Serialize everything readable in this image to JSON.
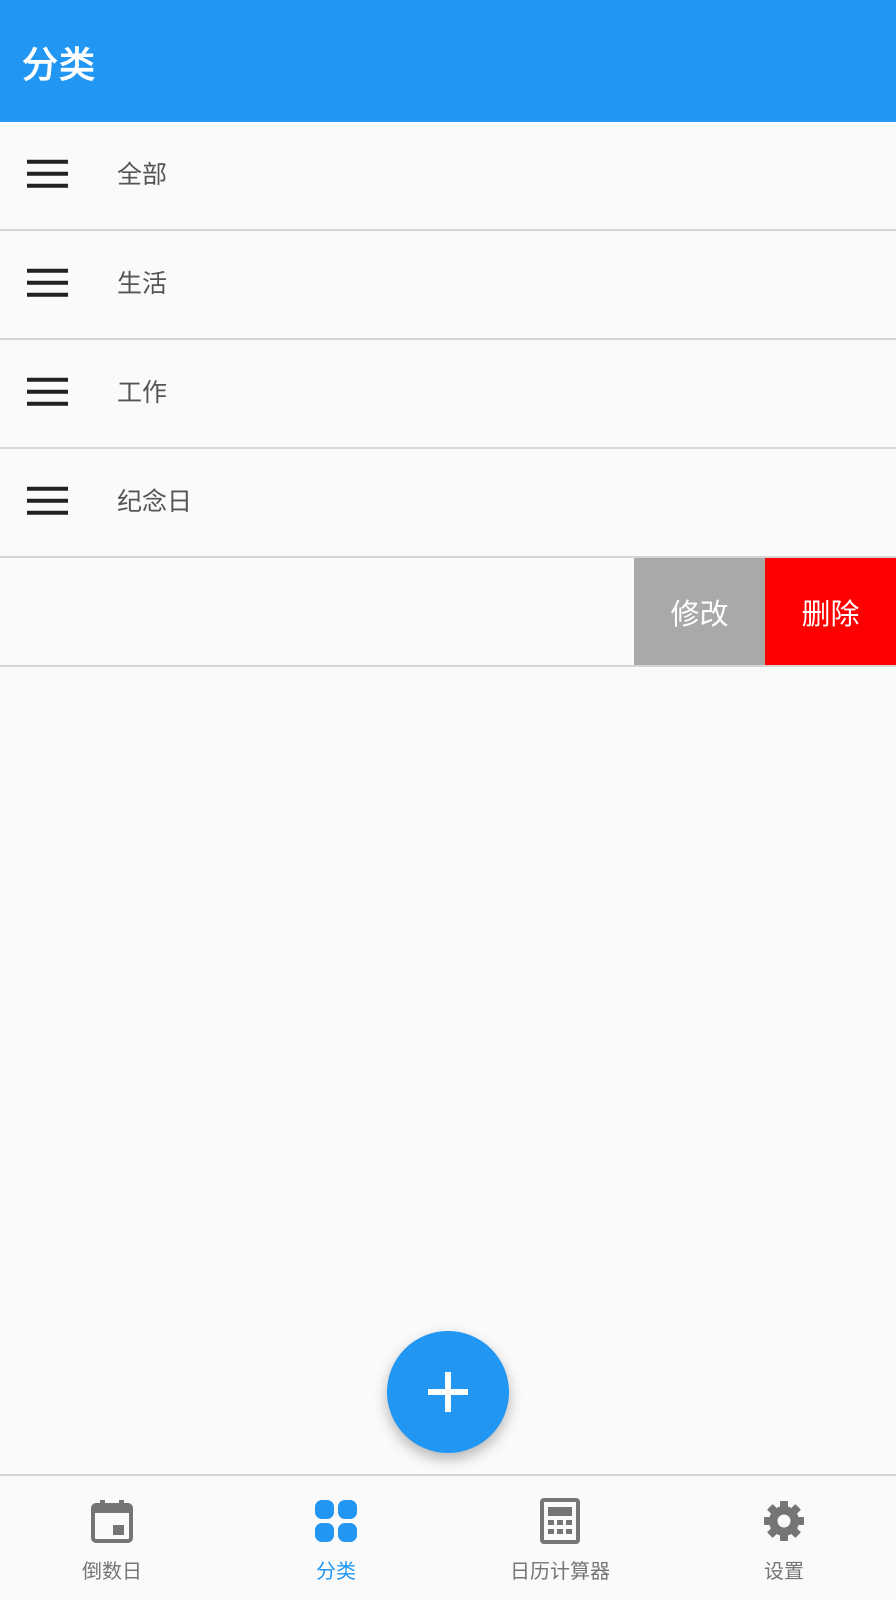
{
  "app_bar": {
    "title": "分类"
  },
  "categories": [
    {
      "label": "全部"
    },
    {
      "label": "生活"
    },
    {
      "label": "工作"
    },
    {
      "label": "纪念日"
    }
  ],
  "swipe_actions": {
    "edit_label": "修改",
    "delete_label": "删除"
  },
  "fab": {
    "icon": "plus-icon"
  },
  "bottom_nav": {
    "items": [
      {
        "label": "倒数日",
        "icon": "calendar-icon",
        "active": false
      },
      {
        "label": "分类",
        "icon": "category-grid-icon",
        "active": true
      },
      {
        "label": "日历计算器",
        "icon": "calculator-icon",
        "active": false
      },
      {
        "label": "设置",
        "icon": "gear-icon",
        "active": false
      }
    ]
  },
  "colors": {
    "primary": "#2196f3",
    "edit_action": "#a9a9a9",
    "delete_action": "#ff0000",
    "inactive_nav": "#757575"
  }
}
